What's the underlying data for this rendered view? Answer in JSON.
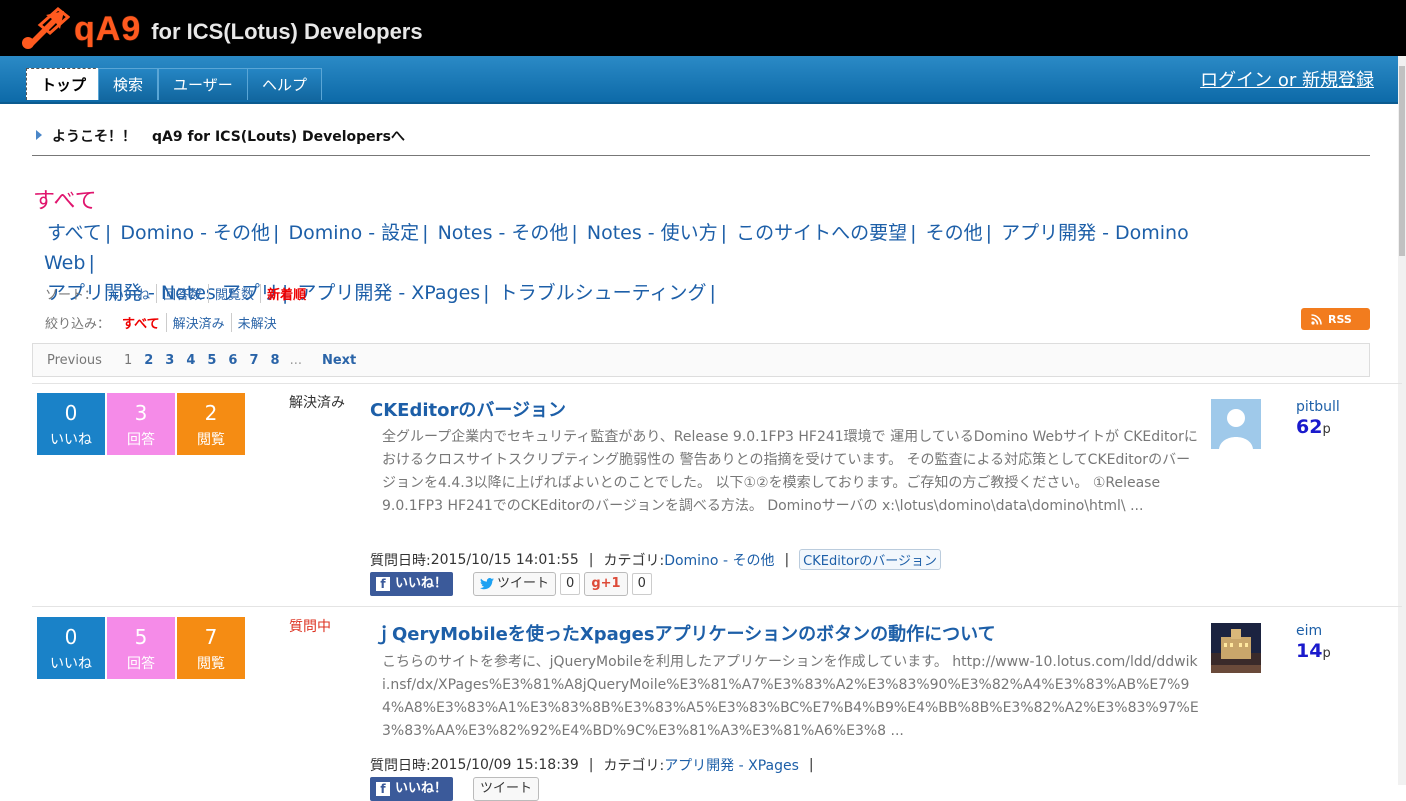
{
  "header": {
    "logo_mark": "qA9",
    "logo_sub": "for ICS(Lotus) Developers"
  },
  "nav": {
    "tabs": [
      {
        "label": "トップ",
        "active": true
      },
      {
        "label": "検索"
      },
      {
        "label": "ユーザー"
      },
      {
        "label": "ヘルプ"
      }
    ],
    "login": "ログイン or 新規登録"
  },
  "welcome": {
    "greeting": "ようこそ！！",
    "site": "qA9 for ICS(Louts) Developersへ"
  },
  "page_title": "すべて",
  "categories": [
    "すべて",
    "Domino - その他",
    "Domino - 設定",
    "Notes - その他",
    "Notes - 使い方",
    "このサイトへの要望",
    "その他",
    "アプリ開発 - Domino Web",
    "アプリ開発 - Notes アプリ",
    "アプリ開発 - XPages",
    "トラブルシューティング"
  ],
  "sort": {
    "label": "ソート：",
    "options": [
      "いいね",
      "回答数",
      "閲覧数",
      "新着順"
    ],
    "active": "新着順"
  },
  "filter": {
    "label": "絞り込み：",
    "options": [
      "すべて",
      "解決済み",
      "未解決"
    ],
    "active": "すべて"
  },
  "rss": "RSS",
  "pager": {
    "previous": "Previous",
    "pages": [
      "1",
      "2",
      "3",
      "4",
      "5",
      "6",
      "7",
      "8"
    ],
    "current": "1",
    "ellipsis": "...",
    "next": "Next"
  },
  "labels": {
    "like": "いいね",
    "answer": "回答",
    "view": "閲覧",
    "fb_like": "いいね！",
    "tweet": "ツイート",
    "gplus": "+1",
    "points_unit": "p",
    "asked": "質問日時:",
    "category": "カテゴリ:"
  },
  "questions": [
    {
      "likes": "0",
      "answers": "3",
      "views": "2",
      "status": "解決済み",
      "title": "CKEditorのバージョン",
      "body": "全グループ企業内でセキュリティ監査があり、Release 9.0.1FP3 HF241環境で 運用しているDomino Webサイトが CKEditorにおけるクロスサイトスクリプティング脆弱性の 警告ありとの指摘を受けています。 その監査による対応策としてCKEditorのバージョンを4.4.3以降に上げればよいとのことでした。 以下①②を模索しております。ご存知の方ご教授ください。 ①Release 9.0.1FP3 HF241でのCKEditorのバージョンを調べる方法。 Dominoサーバの x:\\lotus\\domino\\data\\domino\\html\\ ...",
      "date": "2015/10/15 14:01:55",
      "category": "Domino - その他",
      "tag": "CKEditorのバージョン",
      "tweet_count": "0",
      "gplus_count": "0",
      "user": "pitbull",
      "points": "62"
    },
    {
      "likes": "0",
      "answers": "5",
      "views": "7",
      "status": "質問中",
      "title": "ｊQeryMobileを使ったXpagesアプリケーションのボタンの動作について",
      "body": "こちらのサイトを参考に、jQueryMobileを利用したアプリケーションを作成しています。 http://www-10.lotus.com/ldd/ddwiki.nsf/dx/XPages%E3%81%A8jQueryMoile%E3%81%A7%E3%83%A2%E3%83%90%E3%82%A4%E3%83%AB%E7%94%A8%E3%83%A1%E3%83%8B%E3%83%A5%E3%83%BC%E7%B4%B9%E4%BB%8B%E3%82%A2%E3%83%97%E3%83%AA%E3%82%92%E4%BD%9C%E3%81%A3%E3%81%A6%E3%8 ...",
      "date": "2015/10/09 15:18:39",
      "category": "アプリ開発 - XPages",
      "tag": "",
      "tweet_count": "",
      "gplus_count": "",
      "user": "eim",
      "points": "14"
    }
  ]
}
